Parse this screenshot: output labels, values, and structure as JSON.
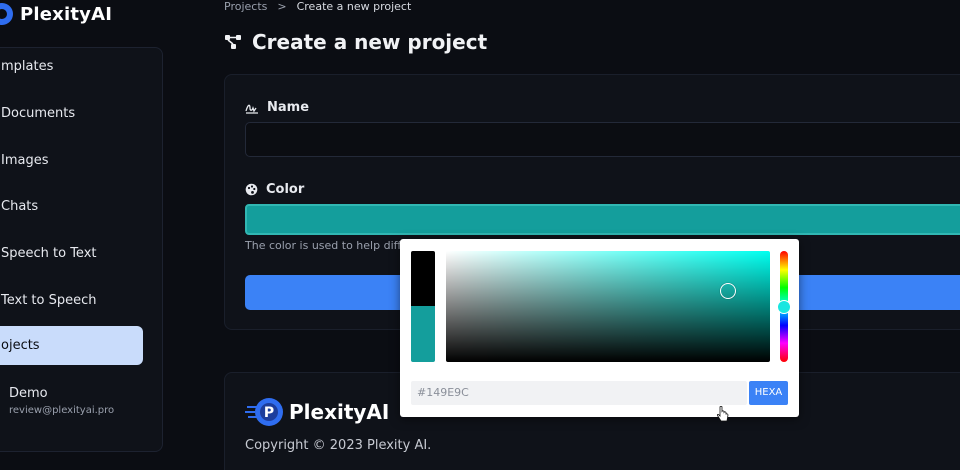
{
  "app": {
    "name": "PlexityAI"
  },
  "colors": {
    "accent": "#3b82f6",
    "selected_color": "#149e9c",
    "active_nav": "#c9dcfb"
  },
  "sidebar": {
    "items": [
      {
        "label": "mplates",
        "icon": "templates-icon"
      },
      {
        "label": "Documents",
        "icon": "documents-icon"
      },
      {
        "label": "Images",
        "icon": "images-icon"
      },
      {
        "label": "Chats",
        "icon": "chats-icon"
      },
      {
        "label": "Speech to Text",
        "icon": "speech-to-text-icon"
      },
      {
        "label": "Text to Speech",
        "icon": "text-to-speech-icon"
      },
      {
        "label": "ojects",
        "icon": "projects-icon",
        "active": true
      }
    ],
    "user": {
      "name": "Demo",
      "email": "review@plexityai.pro"
    }
  },
  "breadcrumb": {
    "parent": "Projects",
    "separator": ">",
    "current": "Create a new project"
  },
  "page": {
    "title": "Create a new project"
  },
  "form": {
    "name_label": "Name",
    "name_value": "",
    "color_label": "Color",
    "help_text": "The color is used to help differe"
  },
  "color_picker": {
    "hex_value": "#149E9C",
    "mode_label": "HEXA",
    "saturation": 0.87,
    "value": 0.64,
    "hue_position": 0.5
  },
  "footer": {
    "logo_text": "PlexityAI",
    "copyright": "Copyright © 2023 Plexity AI."
  }
}
